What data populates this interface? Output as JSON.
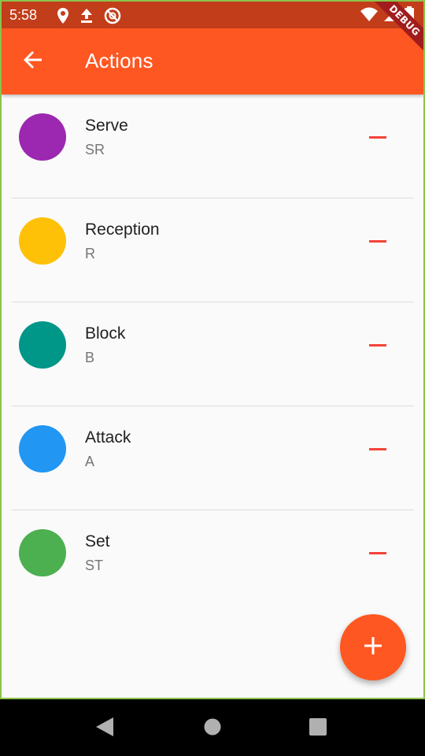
{
  "status_bar": {
    "time": "5:58",
    "icons_left": [
      "location-icon",
      "upload-icon",
      "do-not-disturb-icon"
    ],
    "icons_right": [
      "wifi-icon",
      "signal-icon",
      "battery-icon"
    ]
  },
  "debug_banner": "DEBUG",
  "app_bar": {
    "title": "Actions",
    "back_icon": "arrow-back-icon"
  },
  "actions": [
    {
      "name": "Serve",
      "code": "SR",
      "color": "#9c27b0"
    },
    {
      "name": "Reception",
      "code": "R",
      "color": "#ffc107"
    },
    {
      "name": "Block",
      "code": "B",
      "color": "#009688"
    },
    {
      "name": "Attack",
      "code": "A",
      "color": "#2196f3"
    },
    {
      "name": "Set",
      "code": "ST",
      "color": "#4caf50"
    }
  ],
  "fab": {
    "icon": "add-icon"
  },
  "colors": {
    "primary": "#ff5722",
    "primary_dark": "#c23d1a",
    "remove": "#f44336"
  },
  "nav_bar": {
    "buttons": [
      "back-triangle-icon",
      "home-circle-icon",
      "recents-square-icon"
    ]
  }
}
